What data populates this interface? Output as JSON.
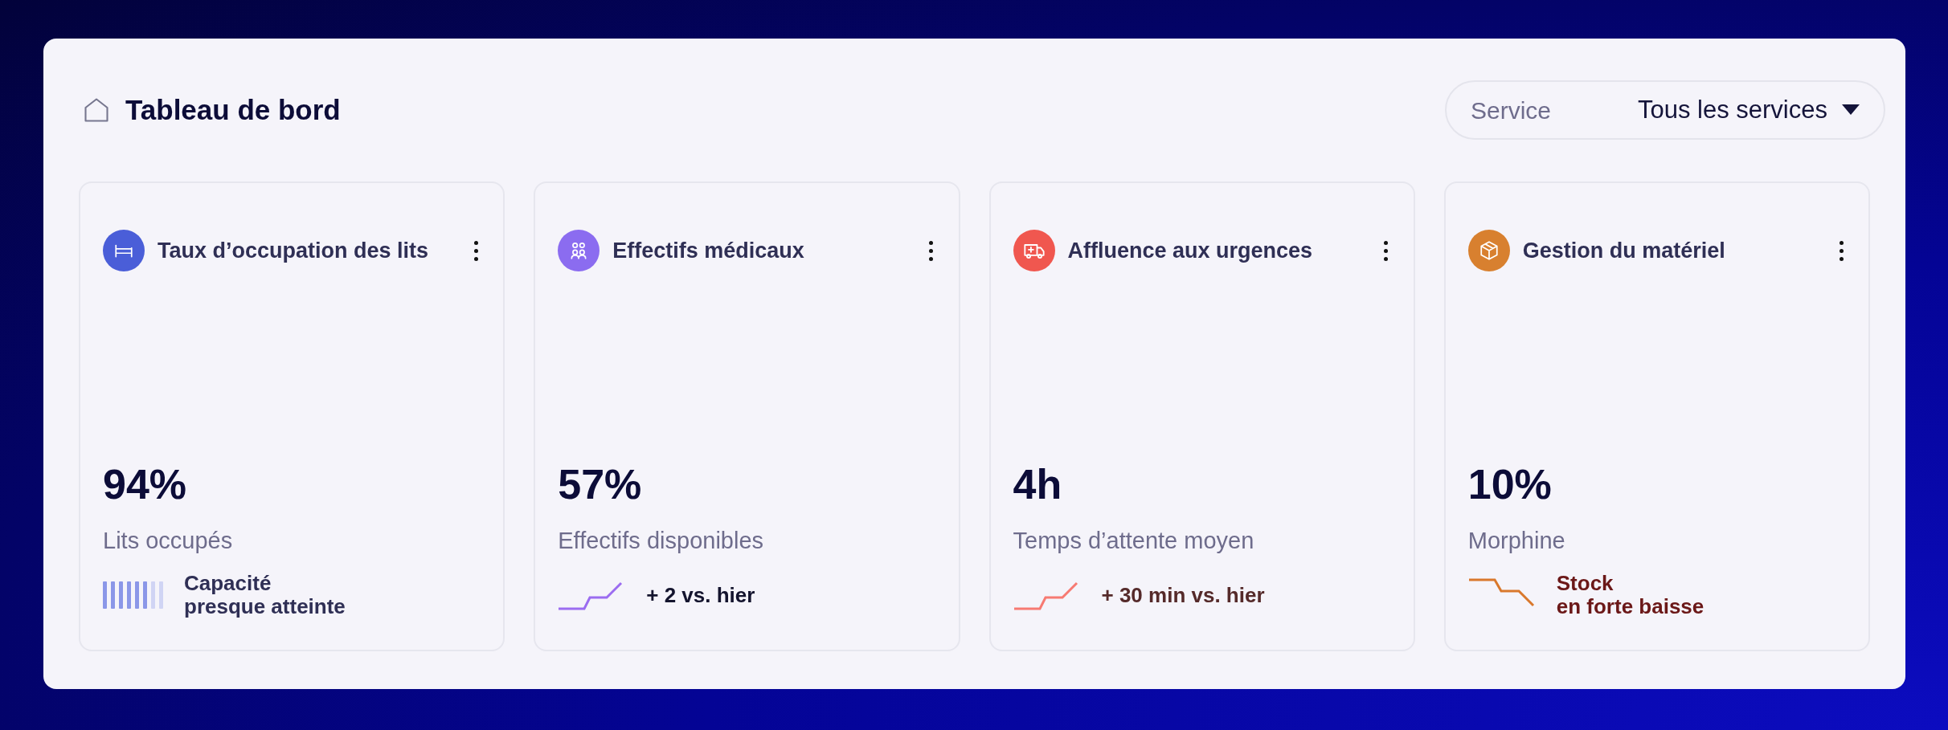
{
  "header": {
    "title": "Tableau de bord"
  },
  "service_filter": {
    "label": "Service",
    "value": "Tous les services"
  },
  "cards": [
    {
      "title": "Taux d’occupation des lits",
      "color": "#4a5ed8",
      "value": "94%",
      "caption": "Lits occupés",
      "indicator": {
        "kind": "bars",
        "level": 0.75,
        "color": "#8b97e8",
        "lines": [
          "Capacité",
          "presque atteinte"
        ]
      }
    },
    {
      "title": "Effectifs médicaux",
      "color": "#8b6cf0",
      "value": "57%",
      "caption": "Effectifs disponibles",
      "indicator": {
        "kind": "trend-up",
        "color": "#9b6cf0",
        "lines": [
          "+ 2 vs. hier"
        ]
      }
    },
    {
      "title": "Affluence aux urgences",
      "color": "#f0574f",
      "value": "4h",
      "caption": "Temps d’attente moyen",
      "indicator": {
        "kind": "trend-up",
        "color": "#f77a72",
        "lines": [
          "+ 30 min vs. hier"
        ]
      }
    },
    {
      "title": "Gestion du matériel",
      "color": "#d8802f",
      "value": "10%",
      "caption": "Morphine",
      "indicator": {
        "kind": "trend-down",
        "color": "#d9782c",
        "lines": [
          "Stock",
          "en forte baisse"
        ]
      }
    }
  ]
}
